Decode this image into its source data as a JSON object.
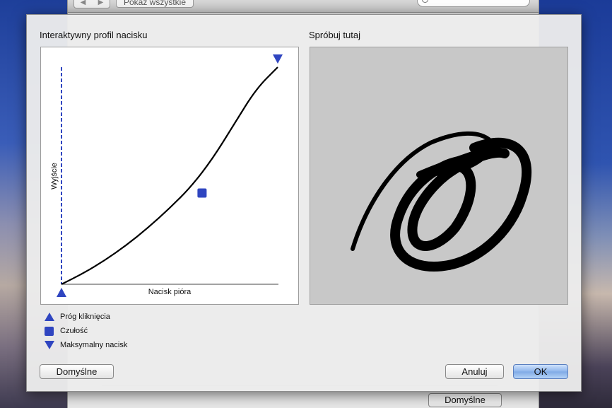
{
  "parent": {
    "nav_back": "◀",
    "nav_forward": "▶",
    "show_all_label": "Pokaż wszystkie",
    "defaults_label": "Domyślne"
  },
  "dialog": {
    "left_title": "Interaktywny profil nacisku",
    "right_title": "Spróbuj tutaj",
    "graph": {
      "x_label": "Nacisk pióra",
      "y_label": "Wyjście",
      "accent": "#2f45c0",
      "curve_points": [
        [
          0,
          0
        ],
        [
          0.1,
          0.05
        ],
        [
          0.2,
          0.11
        ],
        [
          0.3,
          0.18
        ],
        [
          0.4,
          0.26
        ],
        [
          0.5,
          0.35
        ],
        [
          0.6,
          0.45
        ],
        [
          0.7,
          0.58
        ],
        [
          0.8,
          0.74
        ],
        [
          0.9,
          0.9
        ],
        [
          1.0,
          1.0
        ]
      ],
      "click_threshold": [
        0,
        0
      ],
      "sensitivity": [
        0.65,
        0.42
      ],
      "max_pressure": [
        1.0,
        1.0
      ]
    },
    "legend": [
      {
        "icon": "triangle-up-icon",
        "label": "Próg kliknięcia"
      },
      {
        "icon": "square-icon",
        "label": "Czułość"
      },
      {
        "icon": "triangle-down-icon",
        "label": "Maksymalny nacisk"
      }
    ],
    "buttons": {
      "defaults": "Domyślne",
      "cancel": "Anuluj",
      "ok": "OK"
    }
  }
}
